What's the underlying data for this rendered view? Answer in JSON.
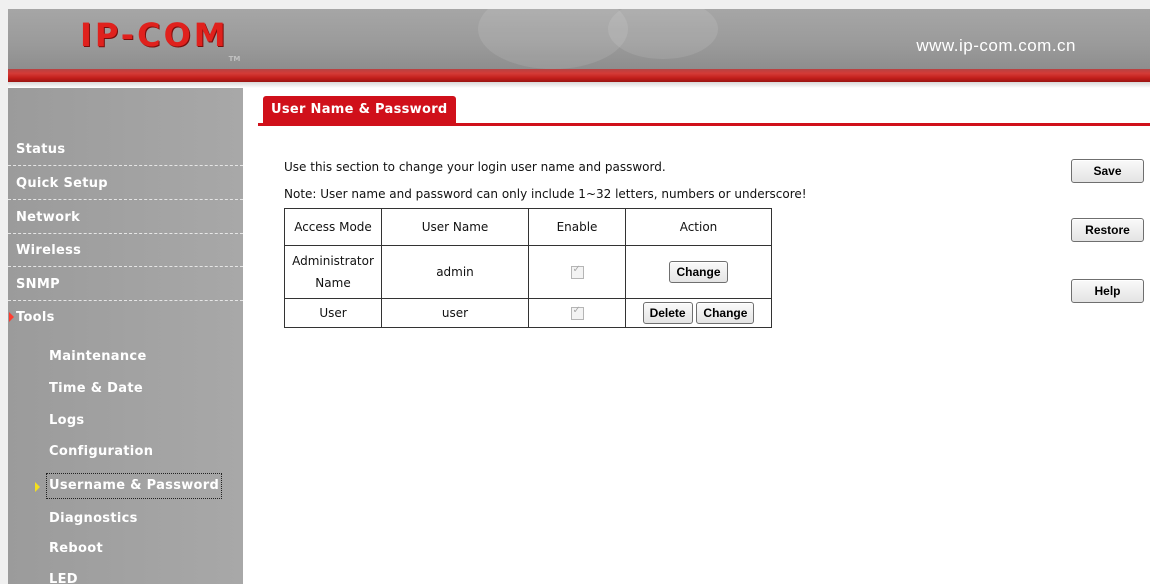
{
  "header": {
    "logo": "IP-COM",
    "logo_mark": "TM",
    "url": "www.ip-com.com.cn"
  },
  "sidebar": {
    "items": [
      {
        "label": "Status"
      },
      {
        "label": "Quick Setup"
      },
      {
        "label": "Network"
      },
      {
        "label": "Wireless"
      },
      {
        "label": "SNMP"
      },
      {
        "label": "Tools",
        "expanded": true
      }
    ],
    "tools_sub": [
      {
        "label": "Maintenance"
      },
      {
        "label": "Time & Date"
      },
      {
        "label": "Logs"
      },
      {
        "label": "Configuration"
      },
      {
        "label": "Username & Password",
        "selected": true
      },
      {
        "label": "Diagnostics"
      },
      {
        "label": "Reboot"
      },
      {
        "label": "LED"
      }
    ]
  },
  "main": {
    "tab_title": "User Name & Password",
    "description": "Use this section to change your login user name and password.",
    "note": "Note: User name and password can only include 1~32 letters, numbers or underscore!",
    "table": {
      "headers": [
        "Access Mode",
        "User Name",
        "Enable",
        "Action"
      ],
      "rows": [
        {
          "access_mode_line1": "Administrator",
          "access_mode_line2": "Name",
          "user_name": "admin",
          "enabled": true,
          "actions": [
            "Change"
          ]
        },
        {
          "access_mode": "User",
          "user_name": "user",
          "enabled": true,
          "actions": [
            "Delete",
            "Change"
          ]
        }
      ]
    }
  },
  "buttons": {
    "save": "Save",
    "restore": "Restore",
    "help": "Help"
  },
  "colors": {
    "accent_red": "#d0101a",
    "sidebar_gray": "#a3a3a3",
    "logo_red": "#e0211d"
  },
  "icons": {
    "nav_active_arrow": "red-triangle-right-icon",
    "sub_active_arrow": "yellow-triangle-right-icon",
    "checkbox": "checked-disabled-checkbox-icon"
  }
}
